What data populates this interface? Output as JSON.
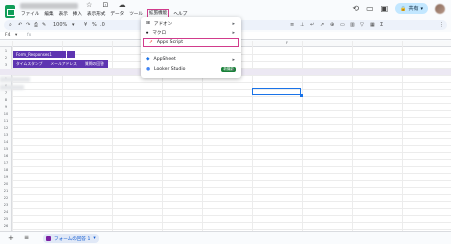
{
  "app": {
    "title": "",
    "title_icons": "☆ ⊡ ☁"
  },
  "menu": [
    "ファイル",
    "編集",
    "表示",
    "挿入",
    "表示形式",
    "データ",
    "ツール",
    "拡張機能",
    "ヘルプ"
  ],
  "toolbar": {
    "undo": "↶",
    "redo": "↷",
    "print": "⎙",
    "zoom": "100%",
    "currency": "¥",
    "percent": "%",
    "decimal": ".0",
    "more": "⋮"
  },
  "formula_bar": {
    "cell_ref": "F4",
    "fx": "fx"
  },
  "share": {
    "label": "共有"
  },
  "grid": {
    "selected_column": "F",
    "form_chip_label": "Form_Responses1",
    "form_columns": [
      "タイムスタンプ",
      "メールアドレス",
      "質問の回答"
    ],
    "row_numbers": [
      "1",
      "2",
      "3",
      "4",
      "5",
      "6",
      "7",
      "8",
      "9",
      "10",
      "11",
      "12",
      "13",
      "14",
      "15",
      "16",
      "17",
      "18",
      "19",
      "20",
      "21",
      "22",
      "23",
      "24",
      "25",
      "26"
    ]
  },
  "dropdown": {
    "items": [
      {
        "label": "アドオン",
        "icon": "addon-icon",
        "has_submenu": true
      },
      {
        "label": "マクロ",
        "icon": "macro-icon",
        "has_submenu": true
      },
      {
        "label": "Apps Script",
        "icon": "apps-script-icon",
        "has_submenu": false,
        "highlighted": true
      },
      {
        "label": "AppSheet",
        "icon": "appsheet-icon",
        "has_submenu": true
      },
      {
        "label": "Looker Studio",
        "icon": "looker-studio-icon",
        "has_submenu": true,
        "badge": "新機能"
      }
    ]
  },
  "sheets": {
    "add": "+",
    "all_sheets": "≡",
    "active_tab": "フォームの回答 1",
    "tab_menu": "▾"
  },
  "colors": {
    "accent": "#1a73e8",
    "highlight": "#d13b8c",
    "form_purple": "#5e35b1",
    "new_badge": "#188038"
  }
}
